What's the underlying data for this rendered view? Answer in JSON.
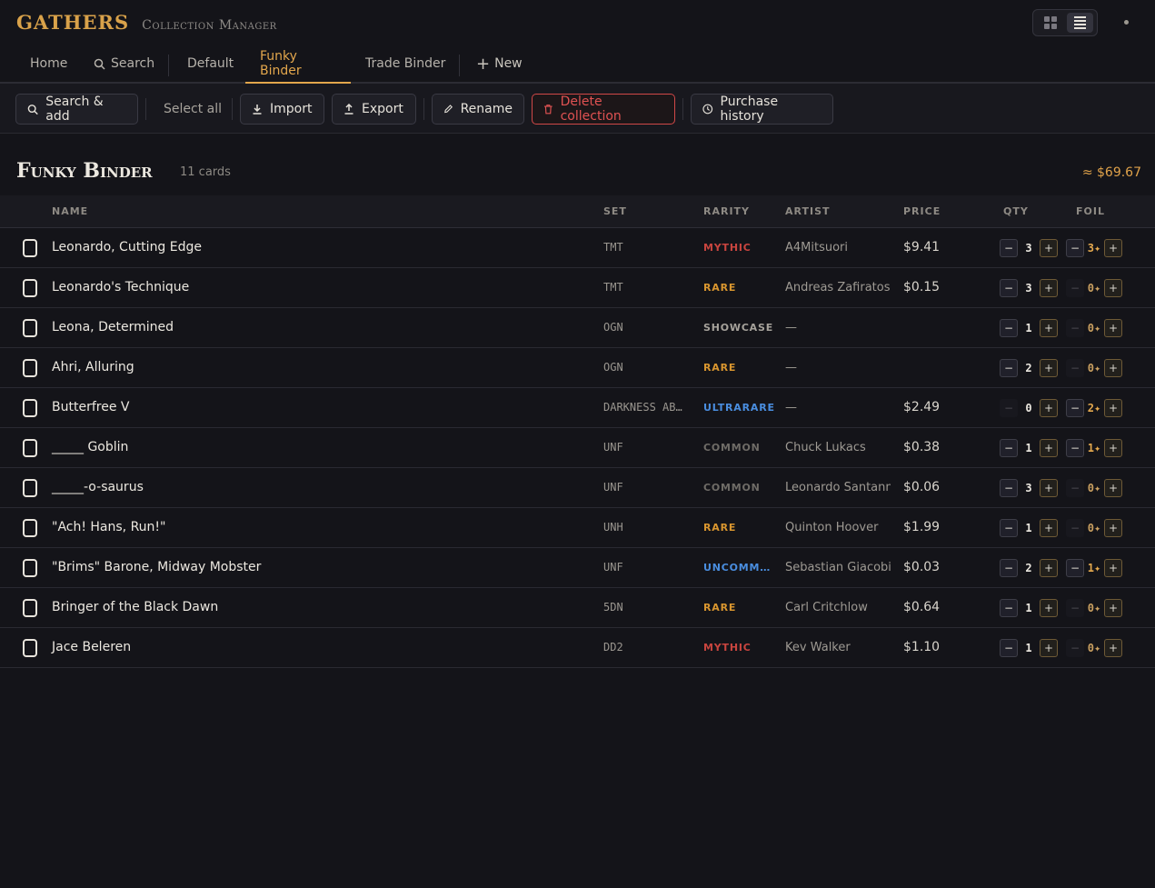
{
  "app": {
    "logo": "GATHERS",
    "subtitle": "Collection Manager"
  },
  "tabs": [
    {
      "label": "Home",
      "icon": "",
      "active": false
    },
    {
      "label": "Search",
      "icon": "search-icon",
      "active": false
    },
    {
      "label": "Default",
      "icon": "",
      "active": false
    },
    {
      "label": "Funky Binder",
      "icon": "",
      "active": true
    },
    {
      "label": "Trade Binder",
      "icon": "",
      "active": false
    },
    {
      "label": "New",
      "icon": "plus-icon",
      "active": false
    }
  ],
  "toolbar": {
    "search_add": "Search & add",
    "select_all": "Select all",
    "import": "Import",
    "export": "Export",
    "rename": "Rename",
    "delete": "Delete collection",
    "history": "Purchase history"
  },
  "collection": {
    "title": "Funky Binder",
    "count": "11 cards",
    "total": "≈ $69.67"
  },
  "columns": {
    "name": "NAME",
    "set": "SET",
    "rarity": "RARITY",
    "artist": "ARTIST",
    "price": "PRICE",
    "qty": "QTY",
    "foil": "FOIL"
  },
  "colors": {
    "mythic": "#c9453f",
    "rare": "#d9962f",
    "showcase": "#a6a29b",
    "ultrarare": "#4a8ee0",
    "uncommon": "#4a8ee0",
    "common": "#6f6c67",
    "accent": "#e2a64c"
  },
  "rows": [
    {
      "name": "Leonardo, Cutting Edge",
      "set": "TMT",
      "rarity": "MYTHIC",
      "rarity_key": "mythic",
      "artist": "A4Mitsuori",
      "price": "$9.41",
      "qty": "3",
      "foil": "3✦"
    },
    {
      "name": "Leonardo's Technique",
      "set": "TMT",
      "rarity": "RARE",
      "rarity_key": "rare",
      "artist": "Andreas Zafiratos",
      "price": "$0.15",
      "qty": "3",
      "foil": "0✦"
    },
    {
      "name": "Leona, Determined",
      "set": "OGN",
      "rarity": "SHOWCASE",
      "rarity_key": "showcase",
      "artist": "—",
      "price": "",
      "qty": "1",
      "foil": "0✦"
    },
    {
      "name": "Ahri, Alluring",
      "set": "OGN",
      "rarity": "RARE",
      "rarity_key": "rare",
      "artist": "—",
      "price": "",
      "qty": "2",
      "foil": "0✦"
    },
    {
      "name": "Butterfree V",
      "set": "DARKNESS AB…",
      "rarity": "ULTRARARE",
      "rarity_key": "ultrarare",
      "artist": "—",
      "price": "$2.49",
      "qty": "0",
      "foil": "2✦"
    },
    {
      "name": "_____ Goblin",
      "set": "UNF",
      "rarity": "COMMON",
      "rarity_key": "common",
      "artist": "Chuck Lukacs",
      "price": "$0.38",
      "qty": "1",
      "foil": "1✦"
    },
    {
      "name": "_____-o-saurus",
      "set": "UNF",
      "rarity": "COMMON",
      "rarity_key": "common",
      "artist": "Leonardo Santanna",
      "price": "$0.06",
      "qty": "3",
      "foil": "0✦"
    },
    {
      "name": "\"Ach! Hans, Run!\"",
      "set": "UNH",
      "rarity": "RARE",
      "rarity_key": "rare",
      "artist": "Quinton Hoover",
      "price": "$1.99",
      "qty": "1",
      "foil": "0✦"
    },
    {
      "name": "\"Brims\" Barone, Midway Mobster",
      "set": "UNF",
      "rarity": "UNCOMM…",
      "rarity_key": "uncommon",
      "artist": "Sebastian Giacobi…",
      "price": "$0.03",
      "qty": "2",
      "foil": "1✦"
    },
    {
      "name": "Bringer of the Black Dawn",
      "set": "5DN",
      "rarity": "RARE",
      "rarity_key": "rare",
      "artist": "Carl Critchlow",
      "price": "$0.64",
      "qty": "1",
      "foil": "0✦"
    },
    {
      "name": "Jace Beleren",
      "set": "DD2",
      "rarity": "MYTHIC",
      "rarity_key": "mythic",
      "artist": "Kev Walker",
      "price": "$1.10",
      "qty": "1",
      "foil": "0✦"
    }
  ]
}
